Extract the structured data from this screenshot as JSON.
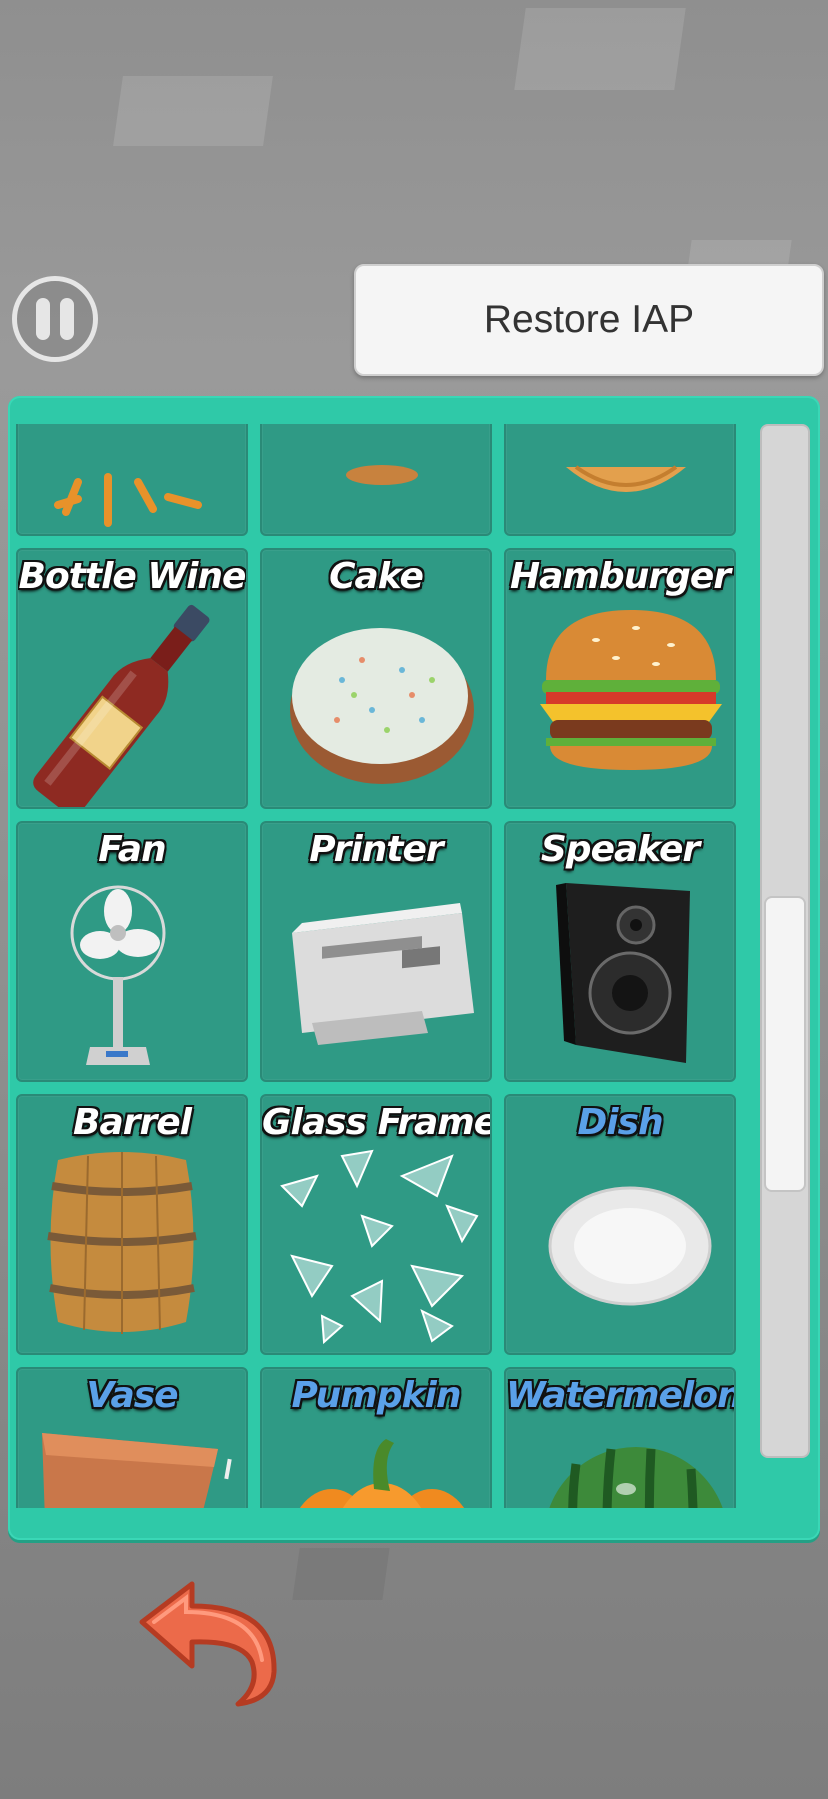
{
  "header": {
    "restore_label": "Restore IAP"
  },
  "items": [
    {
      "label": "",
      "icon": "sunburst-icon",
      "locked": false
    },
    {
      "label": "",
      "icon": "cookie-icon",
      "locked": false
    },
    {
      "label": "",
      "icon": "cupcake-icon",
      "locked": false
    },
    {
      "label": "Bottle Wine",
      "icon": "wine-bottle-icon",
      "locked": false
    },
    {
      "label": "Cake",
      "icon": "cake-icon",
      "locked": false
    },
    {
      "label": "Hamburger",
      "icon": "hamburger-icon",
      "locked": false
    },
    {
      "label": "Fan",
      "icon": "fan-icon",
      "locked": false
    },
    {
      "label": "Printer",
      "icon": "printer-icon",
      "locked": false
    },
    {
      "label": "Speaker",
      "icon": "speaker-icon",
      "locked": false
    },
    {
      "label": "Barrel",
      "icon": "barrel-icon",
      "locked": false
    },
    {
      "label": "Glass Frame",
      "icon": "broken-glass-icon",
      "locked": false
    },
    {
      "label": "Dish",
      "icon": "dish-icon",
      "locked": true
    },
    {
      "label": "Vase",
      "icon": "vase-icon",
      "locked": true
    },
    {
      "label": "Pumpkin",
      "icon": "pumpkin-icon",
      "locked": true
    },
    {
      "label": "Watermelon",
      "icon": "watermelon-icon",
      "locked": true
    }
  ],
  "scrollbar": {
    "position": 0.45,
    "visible_fraction": 0.29
  },
  "colors": {
    "panel": "#2fc9a8",
    "cell": "#2f9a85",
    "locked_label": "#5aa0e8"
  },
  "controls": {
    "pause_icon": "pause-icon",
    "back_icon": "back-arrow-icon"
  }
}
